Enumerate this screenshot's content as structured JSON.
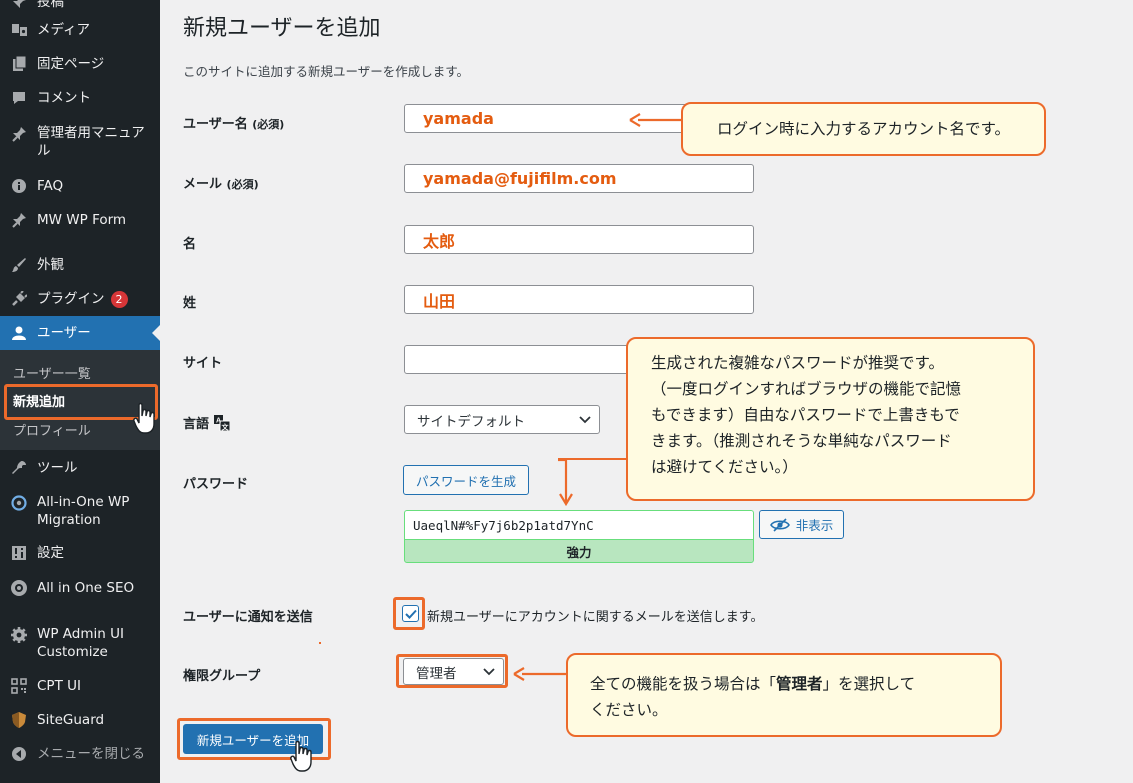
{
  "sidebar": {
    "items": [
      {
        "id": "posts",
        "label": "投稿",
        "icon": "pin-icon"
      },
      {
        "id": "media",
        "label": "メディア",
        "icon": "media-icon"
      },
      {
        "id": "pages",
        "label": "固定ページ",
        "icon": "pages-icon"
      },
      {
        "id": "comments",
        "label": "コメント",
        "icon": "comment-icon"
      },
      {
        "id": "manual",
        "label": "管理者用マニュアル",
        "icon": "pin-icon"
      },
      {
        "id": "faq",
        "label": "FAQ",
        "icon": "info-icon"
      },
      {
        "id": "mwwpform",
        "label": "MW WP Form",
        "icon": "pin-icon"
      },
      {
        "id": "appearance",
        "label": "外観",
        "icon": "brush-icon"
      },
      {
        "id": "plugins",
        "label": "プラグイン",
        "icon": "plugin-icon",
        "badge": "2"
      },
      {
        "id": "users",
        "label": "ユーザー",
        "icon": "user-icon"
      },
      {
        "id": "tools",
        "label": "ツール",
        "icon": "wrench-icon"
      },
      {
        "id": "aiowpm",
        "label": "All-in-One WP Migration",
        "icon": "migration-icon"
      },
      {
        "id": "settings",
        "label": "設定",
        "icon": "settings-icon"
      },
      {
        "id": "aioseo",
        "label": "All in One SEO",
        "icon": "seo-icon"
      },
      {
        "id": "wpadminui",
        "label": "WP Admin UI Customize",
        "icon": "gear-icon"
      },
      {
        "id": "cptui",
        "label": "CPT UI",
        "icon": "grid-icon"
      },
      {
        "id": "siteguard",
        "label": "SiteGuard",
        "icon": "shield-icon"
      },
      {
        "id": "collapse",
        "label": "メニューを閉じる",
        "icon": "collapse-icon"
      }
    ],
    "submenu": [
      "ユーザー一覧",
      "新規追加",
      "プロフィール"
    ]
  },
  "page": {
    "title": "新規ユーザーを追加",
    "description": "このサイトに追加する新規ユーザーを作成します。"
  },
  "form": {
    "username_label": "ユーザー名",
    "username_required": "(必須)",
    "username_value": "yamada",
    "email_label": "メール",
    "email_required": "(必須)",
    "email_value": "yamada@fujifilm.com",
    "firstname_label": "名",
    "firstname_value": "太郎",
    "lastname_label": "姓",
    "lastname_value": "山田",
    "site_label": "サイト",
    "site_value": "",
    "language_label": "言語",
    "language_value": "サイトデフォルト",
    "password_label": "パスワード",
    "generate_button": "パスワードを生成",
    "password_value": "UaeqlN#%Fy7j6b2p1atd7YnC",
    "hide_button": "非表示",
    "strength": "強力",
    "notify_label": "ユーザーに通知を送信",
    "notify_checked": true,
    "notify_text": "新規ユーザーにアカウントに関するメールを送信します。",
    "role_label": "権限グループ",
    "role_value": "管理者",
    "submit_button": "新規ユーザーを追加"
  },
  "callouts": {
    "username": "ログイン時に入力するアカウント名です。",
    "password_lines": [
      "生成された複雑なパスワードが推奨です。",
      "（一度ログインすればブラウザの機能で記憶",
      "もできます）自由なパスワードで上書きもで",
      "きます。（推測されそうな単純なパスワード",
      "は避けてください。）"
    ],
    "role_prefix": "全ての機能を扱う場合は「",
    "role_bold": "管理者",
    "role_suffix": "」を選択して",
    "role_line2": "ください。"
  },
  "colors": {
    "sidebar_bg": "#1d2327",
    "accent": "#2271b1",
    "highlight": "#ec6a2b",
    "callout_bg": "#fffbe1",
    "strength_bg": "#b8e6bf"
  }
}
